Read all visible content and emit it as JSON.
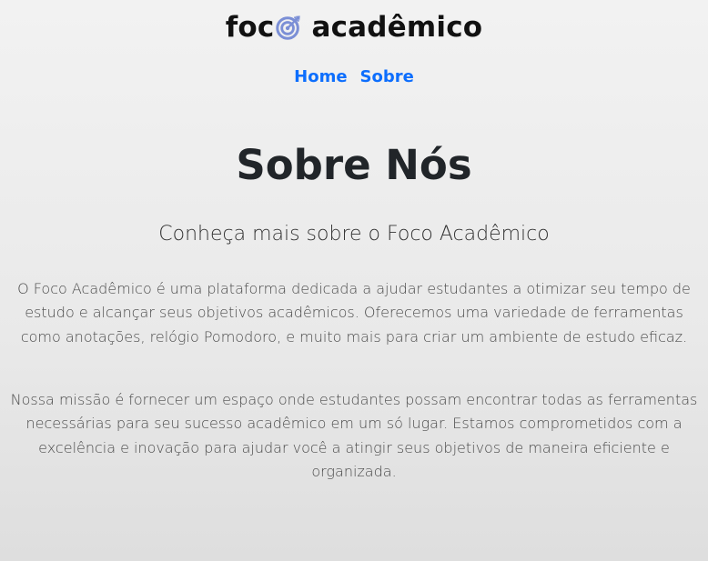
{
  "brand": {
    "word_left": "foc",
    "word_right": "acadêmico",
    "logo_icon": "target-dart-icon",
    "icon_color": "#7b8fd6"
  },
  "nav": {
    "items": [
      {
        "label": "Home"
      },
      {
        "label": "Sobre"
      }
    ],
    "link_color": "#0d6efd"
  },
  "main": {
    "title": "Sobre Nós",
    "subtitle": "Conheça mais sobre o Foco Acadêmico",
    "paragraphs": [
      "O Foco Acadêmico é uma plataforma dedicada a ajudar estudantes a otimizar seu tempo de estudo e alcançar seus objetivos acadêmicos. Oferecemos uma variedade de ferramentas como anotações, relógio Pomodoro, e muito mais para criar um ambiente de estudo eficaz.",
      "Nossa missão é fornecer um espaço onde estudantes possam encontrar todas as ferramentas necessárias para seu sucesso acadêmico em um só lugar. Estamos comprometidos com a excelência e inovação para ajudar você a atingir seus objetivos de maneira eficiente e organizada."
    ]
  }
}
